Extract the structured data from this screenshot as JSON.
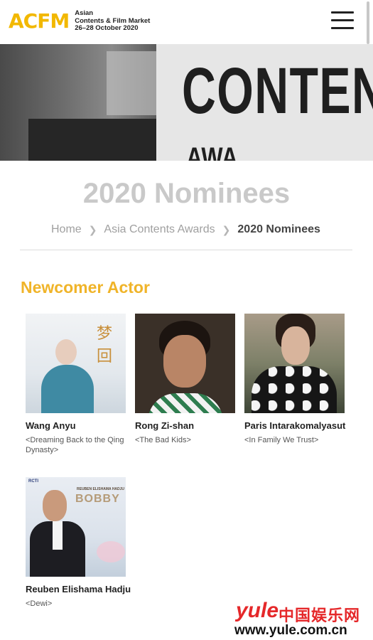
{
  "header": {
    "logo": "ACFM",
    "logo_lines": [
      "Asian",
      "Contents & Film Market",
      "26–28 October 2020"
    ],
    "menu_icon": "hamburger-menu-icon"
  },
  "hero": {
    "sign_text": "CONTENT",
    "sign_text_2": "AWA"
  },
  "page": {
    "title": "2020 Nominees",
    "breadcrumb": [
      "Home",
      "Asia Contents Awards",
      "2020 Nominees"
    ],
    "breadcrumb_separator_icon": "chevron-right-icon"
  },
  "section": {
    "title": "Newcomer Actor",
    "accent_color": "#f0b429",
    "nominees": [
      {
        "name": "Wang Anyu",
        "drama": "<Dreaming Back to the Qing Dynasty>",
        "photo_text": "梦回"
      },
      {
        "name": "Rong Zi-shan",
        "drama": "<The Bad Kids>"
      },
      {
        "name": "Paris Intarakomalyasut",
        "drama": "<In Family We Trust>"
      },
      {
        "name": "Reuben Elishama Hadju",
        "drama": "<Dewi>",
        "photo_text": "BOBBY",
        "photo_subtext": "REUBEN ELISHAMA HADJU",
        "photo_brand": "RCTI"
      }
    ]
  },
  "watermark": {
    "brand": "yule",
    "cn": "中国娱乐网",
    "url": "www.yule.com.cn"
  }
}
